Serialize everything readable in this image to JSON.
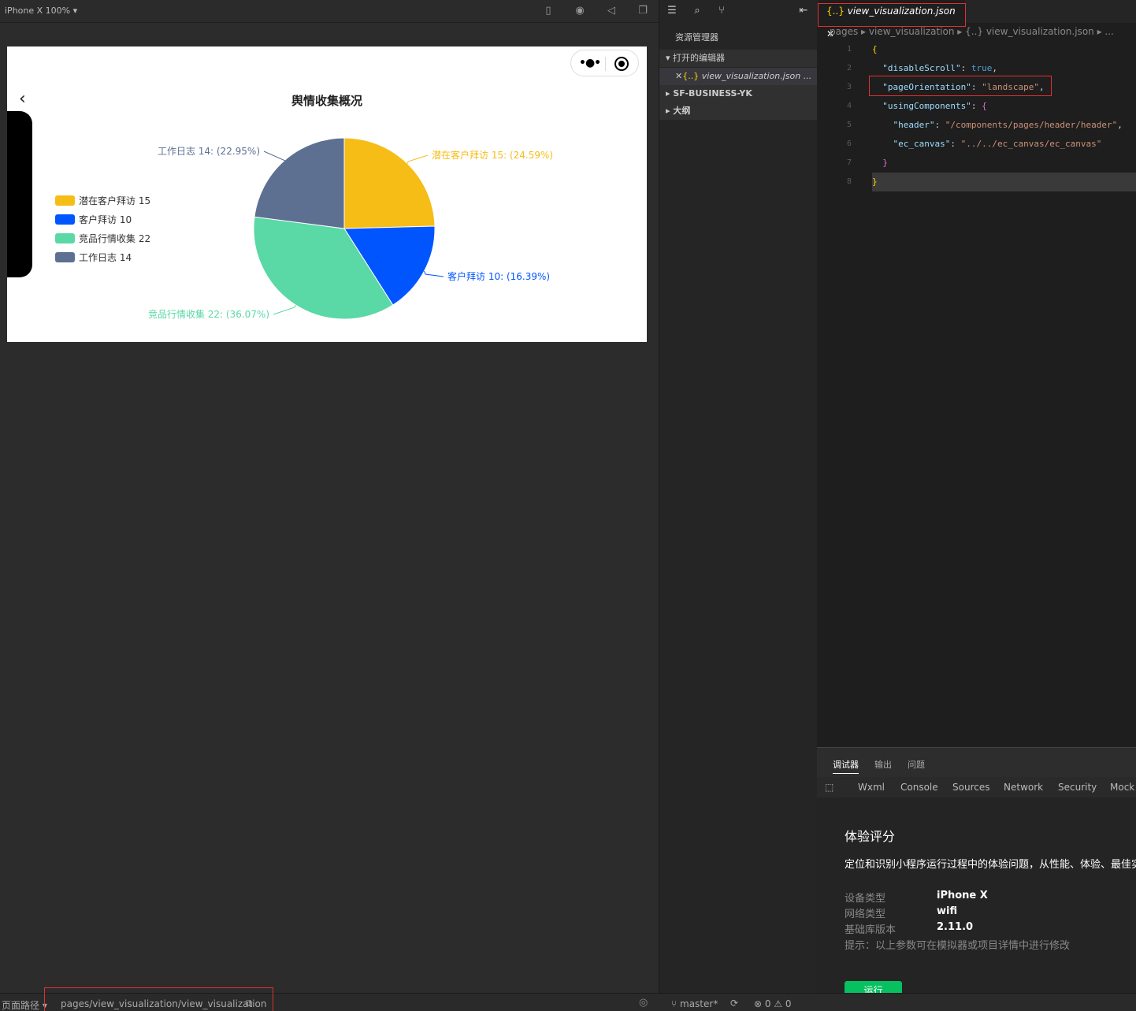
{
  "simulator": {
    "device_label": "iPhone X 100% ▾",
    "page": {
      "title": "舆情收集概况",
      "back_icon": "chevron-left-icon",
      "capsule": {
        "more_icon": "more-dots-icon",
        "close_icon": "target-icon"
      }
    }
  },
  "chart_data": {
    "type": "pie",
    "title": "舆情收集概况",
    "categories": [
      "潜在客户拜访",
      "客户拜访",
      "竞品行情收集",
      "工作日志"
    ],
    "values": [
      15,
      10,
      22,
      14
    ],
    "percents": [
      24.59,
      16.39,
      36.07,
      22.95
    ],
    "colors": [
      "#f6bd16",
      "#0055ff",
      "#5ad8a6",
      "#5d7092"
    ],
    "legend_labels": [
      "潜在客户拜访 15",
      "客户拜访 10",
      "竞品行情收集 22",
      "工作日志 14"
    ],
    "slice_labels": [
      "潜在客户拜访 15: (24.59%)",
      "客户拜访 10: (16.39%)",
      "竞品行情收集 22: (36.07%)",
      "工作日志 14: (22.95%)"
    ],
    "legend_position": "left"
  },
  "explorer": {
    "title": "资源管理器",
    "sections": [
      {
        "label": "打开的编辑器",
        "expanded": true
      },
      {
        "label": "SF-BUSINESS-YK",
        "expanded": false
      },
      {
        "label": "大纲",
        "expanded": false
      }
    ],
    "open_file": "view_visualization.json ..."
  },
  "editor": {
    "tab_label": "view_visualization.json",
    "breadcrumb": "pages ▸ view_visualization ▸ {..} view_visualization.json ▸ ...",
    "lines": [
      {
        "n": "1",
        "html": "{"
      },
      {
        "n": "2",
        "key": "\"disableScroll\"",
        "val": "true",
        "valtype": "b",
        "indent": "  ",
        "tail": ","
      },
      {
        "n": "3",
        "key": "\"pageOrientation\"",
        "val": "\"landscape\"",
        "valtype": "s",
        "indent": "  ",
        "tail": ","
      },
      {
        "n": "4",
        "key": "\"usingComponents\"",
        "val": "{",
        "valtype": "pk",
        "indent": "  ",
        "tail": ""
      },
      {
        "n": "5",
        "key": "\"header\"",
        "val": "\"/components/pages/header/header\"",
        "valtype": "s",
        "indent": "    ",
        "tail": ","
      },
      {
        "n": "6",
        "key": "\"ec_canvas\"",
        "val": "\"../../ec_canvas/ec_canvas\"",
        "valtype": "s",
        "indent": "    ",
        "tail": ""
      },
      {
        "n": "7",
        "html": "  }"
      },
      {
        "n": "8",
        "html": "}"
      }
    ]
  },
  "debugger": {
    "tabs": [
      "调试器",
      "输出",
      "问题"
    ],
    "dev_tabs": [
      "Wxml",
      "Console",
      "Sources",
      "Network",
      "Security",
      "Mock"
    ],
    "score_title": "体验评分",
    "score_desc": "定位和识别小程序运行过程中的体验问题，从性能、体验、最佳实",
    "info": [
      {
        "k": "设备类型",
        "v": "iPhone X"
      },
      {
        "k": "网络类型",
        "v": "wifi"
      },
      {
        "k": "基础库版本",
        "v": "2.11.0"
      }
    ],
    "tip": "提示：以上参数可在模拟器或项目详情中进行修改",
    "run_label": "运行"
  },
  "statusbar": {
    "path_label": "页面路径 ▾",
    "path_value": "pages/view_visualization/view_visualization",
    "branch": "master*",
    "errors": "⊗ 0 ⚠ 0"
  }
}
